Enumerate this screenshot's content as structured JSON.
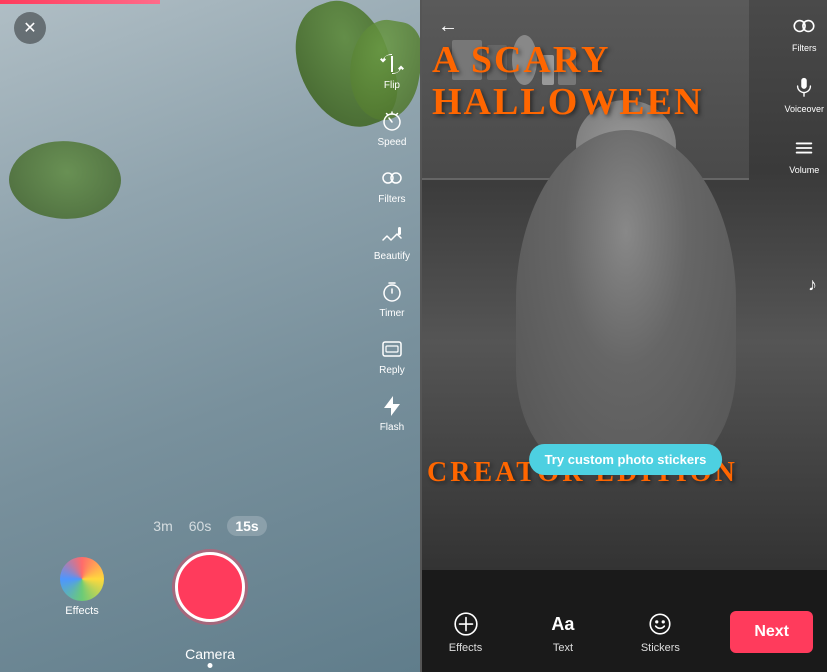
{
  "left": {
    "toolbar": {
      "items": [
        {
          "id": "flip",
          "icon": "🔄",
          "label": "Flip"
        },
        {
          "id": "speed",
          "icon": "⏱",
          "label": "Speed"
        },
        {
          "id": "filters",
          "icon": "✨",
          "label": "Filters"
        },
        {
          "id": "beautify",
          "icon": "✏️",
          "label": "Beautify"
        },
        {
          "id": "timer",
          "icon": "⏲",
          "label": "Timer"
        },
        {
          "id": "reply",
          "icon": "🗂",
          "label": "Reply"
        },
        {
          "id": "flash",
          "icon": "⚡",
          "label": "Flash"
        }
      ]
    },
    "duration_options": [
      {
        "label": "3m",
        "active": false
      },
      {
        "label": "60s",
        "active": false
      },
      {
        "label": "15s",
        "active": true
      }
    ],
    "effects_label": "Effects",
    "camera_label": "Camera"
  },
  "right": {
    "title_line1": "A SCARY",
    "title_line2": "HALLOWEEN",
    "creator_edition": "CREATOR EDITION",
    "toolbar_items": [
      {
        "id": "filters",
        "icon": "⚙",
        "label": "Filters"
      },
      {
        "id": "voiceover",
        "icon": "🎙",
        "label": "Voiceover"
      },
      {
        "id": "volume",
        "icon": "≡",
        "label": "Volume"
      }
    ],
    "sticker_banner": "Try custom photo stickers",
    "bottom_tools": [
      {
        "id": "effects",
        "icon": "⏱",
        "label": "Effects"
      },
      {
        "id": "text",
        "icon": "Aa",
        "label": "Text"
      },
      {
        "id": "stickers",
        "icon": "☺",
        "label": "Stickers"
      }
    ],
    "next_button": "Next"
  }
}
